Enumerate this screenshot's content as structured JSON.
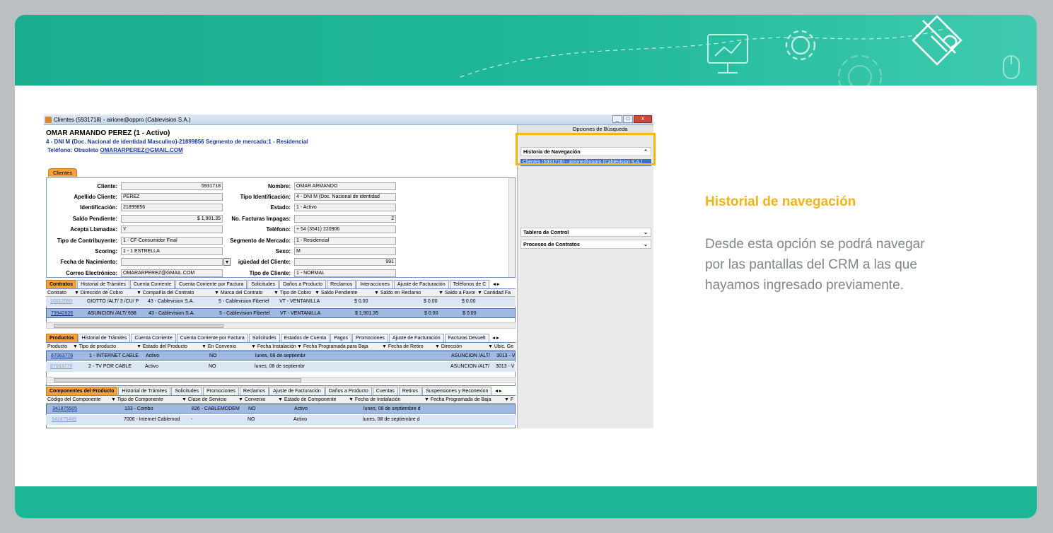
{
  "slide": {
    "side_title": "Historial de navegación",
    "side_body_lines": [
      "Desde esta opción se podrá navegar",
      "por las pantallas del CRM a las que",
      "hayamos ingresado previamente."
    ],
    "colors": {
      "header_teal": "#20b899",
      "accent_yellow": "#f1b418",
      "highlight_border": "#f1b90f",
      "body_text": "#7f868a"
    },
    "header_icons": [
      "presentation-board-icon",
      "gear-icon",
      "pencil-ruler-icon",
      "mouse-icon"
    ]
  },
  "window": {
    "title": "Clientes (5931718) - airione@oppro (Cablevision S.A.)",
    "controls": [
      "_",
      "□",
      "X"
    ]
  },
  "customer": {
    "name_line": "OMAR ARMANDO PEREZ (1 - Activo)",
    "doc_line": "4 - DNI M (Doc. Nacional de identidad Masculino)-21899856 Segmento de mercado:1 - Residencial",
    "tel_prefix": "Teléfono: Obsoleto",
    "email": "OMARARPEREZ@GMAIL.COM"
  },
  "form": {
    "tab": "Clientes",
    "left": [
      {
        "label": "Cliente:",
        "value": "5931718",
        "align": "right"
      },
      {
        "label": "Apellido Cliente:",
        "value": "PEREZ"
      },
      {
        "label": "Identificación:",
        "value": "21899856"
      },
      {
        "label": "Saldo Pendiente:",
        "value": "$ 1,901.35",
        "align": "right"
      },
      {
        "label": "Acepta Llamadas:",
        "value": "Y"
      },
      {
        "label": "Tipo de Contribuyente:",
        "value": "1 - CF-Consumidor Final"
      },
      {
        "label": "Scoring:",
        "value": "1 - 1 ESTRELLA"
      },
      {
        "label": "Fecha de Nacimiento:",
        "value": ""
      },
      {
        "label": "Correo Electrónico:",
        "value": "OMARARPEREZ@GMAIL.COM"
      }
    ],
    "right": [
      {
        "label": "Nombre:",
        "value": "OMAR ARMANDO"
      },
      {
        "label": "Tipo Identificación:",
        "value": "4 - DNI M (Doc. Nacional de identidad"
      },
      {
        "label": "Estado:",
        "value": "1 - Activo"
      },
      {
        "label": "No. Facturas Impagas:",
        "value": "2",
        "align": "right"
      },
      {
        "label": "Teléfono:",
        "value": "+ 54 (3541) 220906"
      },
      {
        "label": "Segmento de Mercado:",
        "value": "1 - Residencial"
      },
      {
        "label": "Sexo:",
        "value": "M"
      },
      {
        "label": "igüedad del Cliente:",
        "value": "991",
        "align": "right"
      },
      {
        "label": "Tipo de Cliente:",
        "value": "1 - NORMAL"
      }
    ]
  },
  "contratos": {
    "tabs": [
      "Contratos",
      "Historial de Trámites",
      "Cuenta Corriente",
      "Cuenta Corriente por Factura",
      "Solicitudes",
      "Daños a Producto",
      "Reclamos",
      "Interacciones",
      "Ajuste de Facturación",
      "Teléfonos de C"
    ],
    "columns": [
      "Contrato",
      "Dirección de Cobro",
      "Compañía del Contrato",
      "Marca del Contrato",
      "Tipo de Cobro",
      "Saldo Pendiente",
      "Saldo en Reclamo",
      "Saldo a Favor",
      "Cantidad Fa"
    ],
    "rows": [
      [
        "10012950",
        "GIOTTO /ALT/ 3 /CU/ P",
        "43 - Cablevision S.A.",
        "5 - Cablevision Fibertel",
        "VT - VENTANILLA",
        "$ 0.00",
        "$ 0.00",
        "$ 0.00"
      ],
      [
        "79942826",
        "ASUNCION /ALT/ 698",
        "43 - Cablevision S.A.",
        "5 - Cablevision Fibertel",
        "VT - VENTANILLA",
        "$ 1,901.35",
        "$ 0.00",
        "$ 0.00"
      ]
    ]
  },
  "productos": {
    "tabs": [
      "Productos",
      "Historial de Trámites",
      "Cuenta Corriente",
      "Cuenta Corriente por Factura",
      "Solicitudes",
      "Estados de Cuenta",
      "Pagos",
      "Promociones",
      "Ajuste de Facturación",
      "Facturas Devuelt"
    ],
    "columns": [
      "Producto",
      "Tipo de producto",
      "Estado del Producto",
      "En Convenio",
      "Fecha Instalación",
      "Fecha Programada para Baja",
      "Fecha de Retiro",
      "Dirección",
      "Ubic. Ge"
    ],
    "rows": [
      [
        "87063778",
        "1 - INTERNET CABLE",
        "Activo",
        "NO",
        "lunes, 08 de septiembr",
        "ASUNCION /ALT/",
        "3013 - V"
      ],
      [
        "87063779",
        "2 - TV POR CABLE",
        "Activo",
        "NO",
        "lunes, 08 de septiembr",
        "ASUNCION /ALT/",
        "3013 - V"
      ]
    ]
  },
  "componentes": {
    "tabs": [
      "Componentes del Producto",
      "Historial de Trámites",
      "Solicitudes",
      "Promociones",
      "Reclamos",
      "Ajuste de Facturación",
      "Daños a Producto",
      "Cuentas",
      "Retiros",
      "Suspensiones y Reconexion"
    ],
    "columns": [
      "Código del Componente",
      "Tipo de Componente",
      "Clase de Servicio",
      "Convenio",
      "Estado de Componente",
      "Fecha de Instalación",
      "Fecha Programada de Baja",
      "F"
    ],
    "rows": [
      [
        "341875505",
        "133 - Combo",
        "826 - CABLEMODEM",
        "NO",
        "Activo",
        "lunes, 08 de septiembre d"
      ],
      [
        "341875499",
        "7006 - Internet Cablemod",
        "-",
        "NO",
        "Activo",
        "lunes, 08 de septiembre d"
      ]
    ]
  },
  "right_panel": {
    "header": "Opciones de Búsqueda",
    "history_title": "Historia de Navegación",
    "history_link": "Clientes (5931718) - airione@oppro (Cablevision S.A.)",
    "tablero": "Tablero de Control",
    "procesos": "Procesos de Contratos"
  },
  "misc": {
    "scroll_grip": "III",
    "filter_glyph": "▼",
    "chev_up": "⌃",
    "chev_down": "⌄"
  }
}
